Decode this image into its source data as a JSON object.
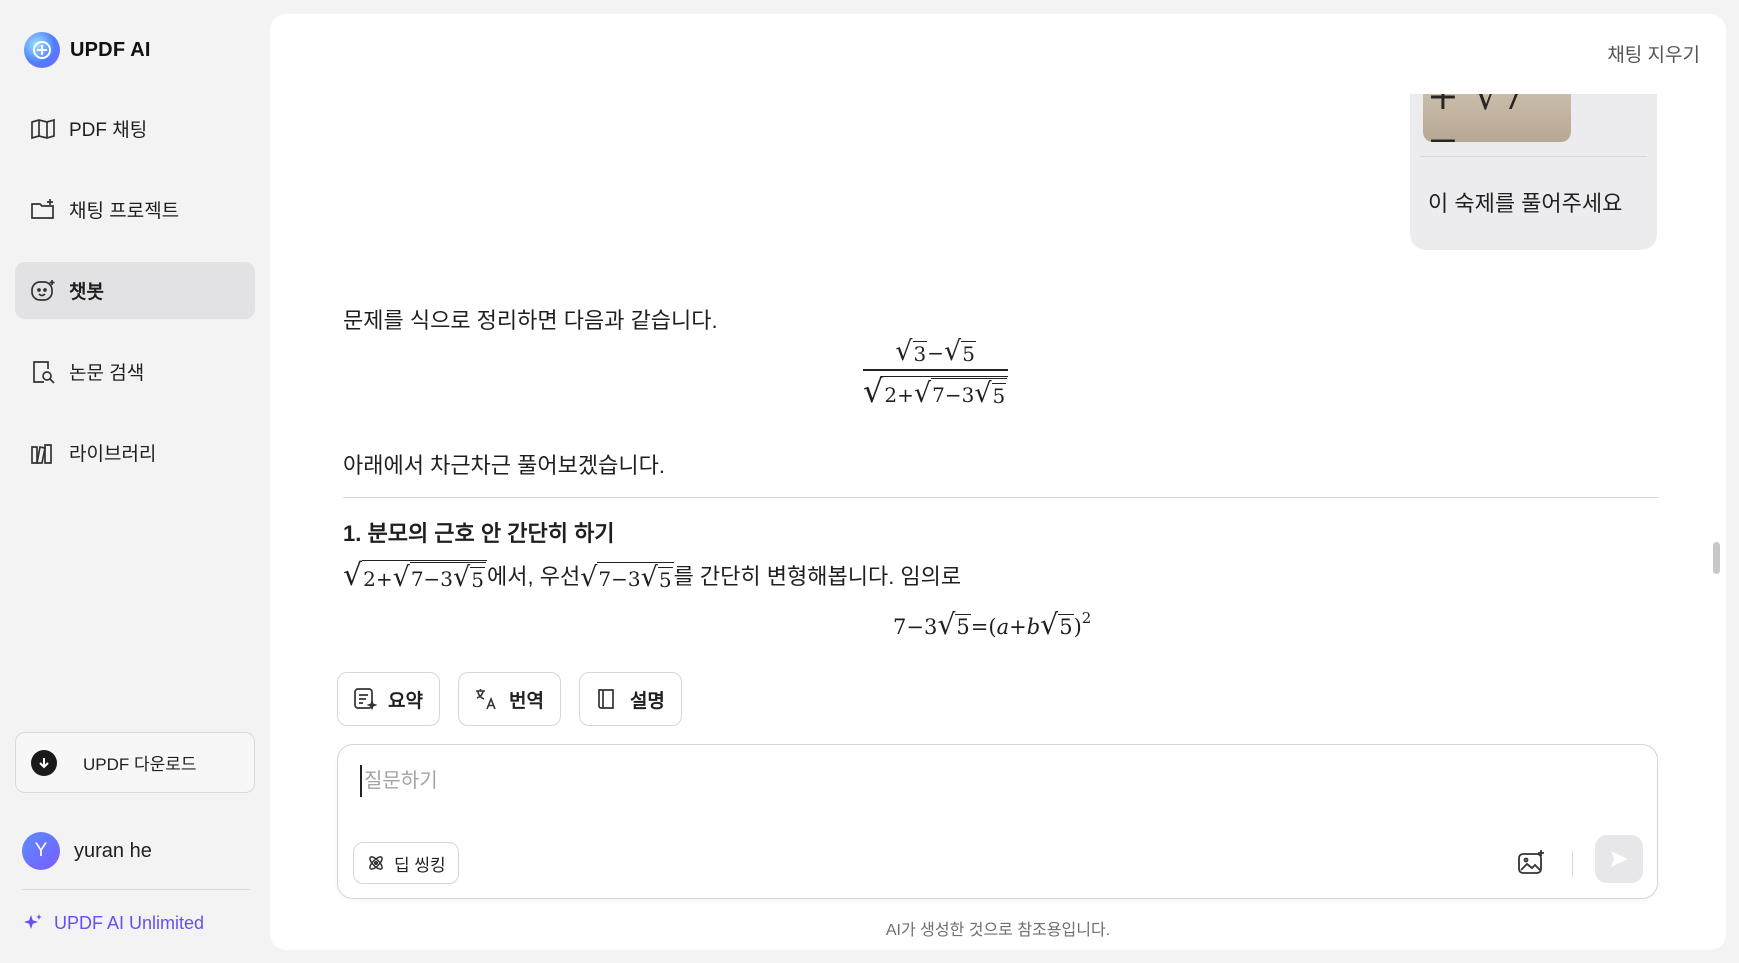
{
  "app": {
    "brand_name": "UPDF AI"
  },
  "sidebar": {
    "items": [
      {
        "label": "PDF 채팅",
        "icon": "open-book-icon",
        "active": false
      },
      {
        "label": "채팅 프로젝트",
        "icon": "folder-add-icon",
        "active": false
      },
      {
        "label": "챗봇",
        "icon": "chatbot-face-icon",
        "active": true
      },
      {
        "label": "논문 검색",
        "icon": "document-search-icon",
        "active": false
      },
      {
        "label": "라이브러리",
        "icon": "library-books-icon",
        "active": false
      }
    ],
    "download_label": "UPDF 다운로드",
    "user": {
      "initial": "Y",
      "name": "yuran he"
    },
    "plan_label": "UPDF AI Unlimited"
  },
  "header": {
    "clear_chat_label": "채팅 지우기"
  },
  "conversation": {
    "user_message": {
      "image_text": "+ √7 −",
      "text": "이 숙제를 풀어주세요"
    },
    "assistant": {
      "intro": "문제를 식으로 정리하면 다음과 같습니다.",
      "expression": {
        "numerator": [
          "3",
          "5"
        ],
        "numerator_op": "−",
        "denominator_outer": "2+",
        "denominator_inner": "7−3",
        "denominator_inner_root": "5"
      },
      "step_intro": "아래에서 차근차근 풀어보겠습니다.",
      "section_title": "1. 분모의 근호 안 간단히 하기",
      "line_text_1": "에서, 우선 ",
      "line_text_2": "를 간단히 변형해봅니다. 임의로",
      "line_math_outer": "2+",
      "line_math_inner": "7−3",
      "line_math_root": "5",
      "equation": {
        "lhs": "7−3",
        "lhs_root": "5",
        "rhs_a": "a",
        "rhs_plus": "+",
        "rhs_b": "b",
        "rhs_root": "5",
        "exponent": "2"
      }
    }
  },
  "quick_actions": [
    {
      "label": "요약",
      "icon": "summary-icon"
    },
    {
      "label": "번역",
      "icon": "translate-icon"
    },
    {
      "label": "설명",
      "icon": "book-icon"
    }
  ],
  "composer": {
    "placeholder": "질문하기",
    "value": "",
    "deep_think_label": "딥 씽킹"
  },
  "footer": {
    "disclaimer": "AI가 생성한 것으로 참조용입니다."
  },
  "colors": {
    "accent": "#6a4ef0",
    "active_nav_bg": "#e2e2e4",
    "page_bg": "#f3f3f4"
  }
}
